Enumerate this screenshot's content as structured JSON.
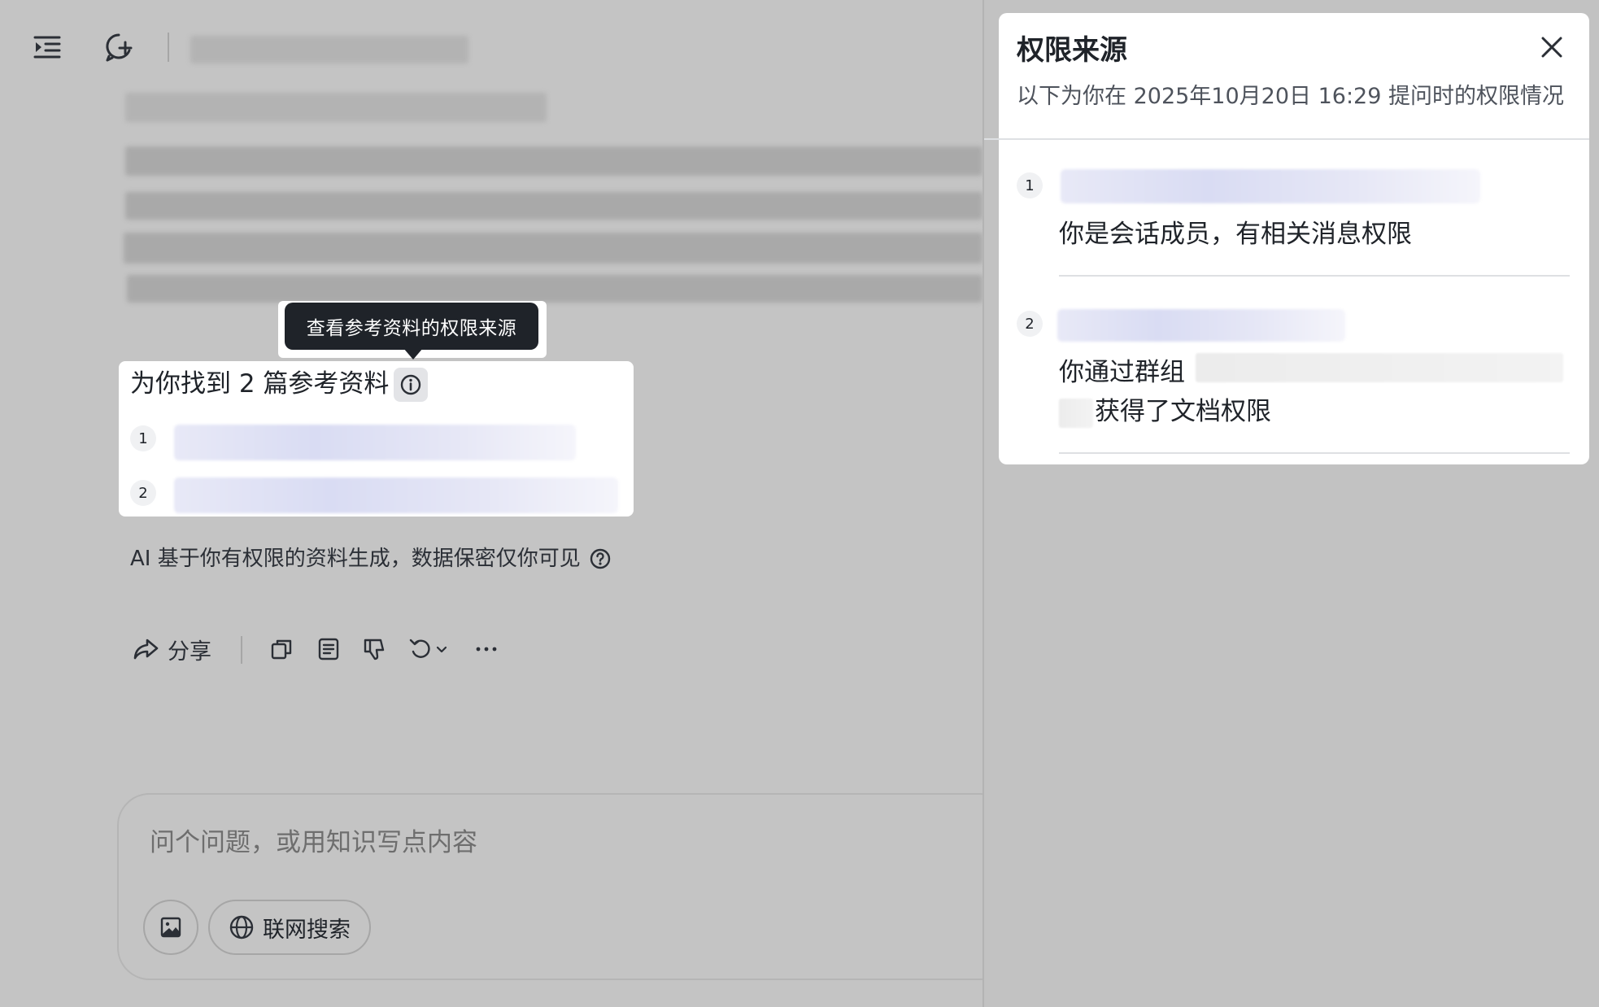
{
  "toolbar": {
    "sidebar_toggle_icon": "sidebar-toggle-icon",
    "new_chat_icon": "new-chat-icon"
  },
  "tooltip": {
    "text": "查看参考资料的权限来源"
  },
  "references": {
    "title": "为你找到 2 篇参考资料",
    "items": [
      {
        "number": "1"
      },
      {
        "number": "2"
      }
    ]
  },
  "disclaimer": {
    "text": "AI 基于你有权限的资料生成，数据保密仅你可见"
  },
  "actions": {
    "share_label": "分享",
    "icons": [
      "share-icon",
      "copy-icon",
      "document-icon",
      "thumbs-down-icon",
      "regenerate-icon",
      "more-icon"
    ]
  },
  "input": {
    "placeholder": "问个问题，或用知识写点内容",
    "web_search_label": "联网搜索"
  },
  "permission_panel": {
    "title": "权限来源",
    "subtitle": "以下为你在 2025年10月20日 16:29 提问时的权限情况",
    "items": [
      {
        "number": "1",
        "reason": "你是会话成员，有相关消息权限"
      },
      {
        "number": "2",
        "reason_prefix": "你通过群组",
        "reason_suffix": "获得了文档权限"
      }
    ]
  },
  "colors": {
    "overlay": "#c4c4c4",
    "card": "#ffffff",
    "tooltip": "#1f2329",
    "text": "#1f2329"
  }
}
